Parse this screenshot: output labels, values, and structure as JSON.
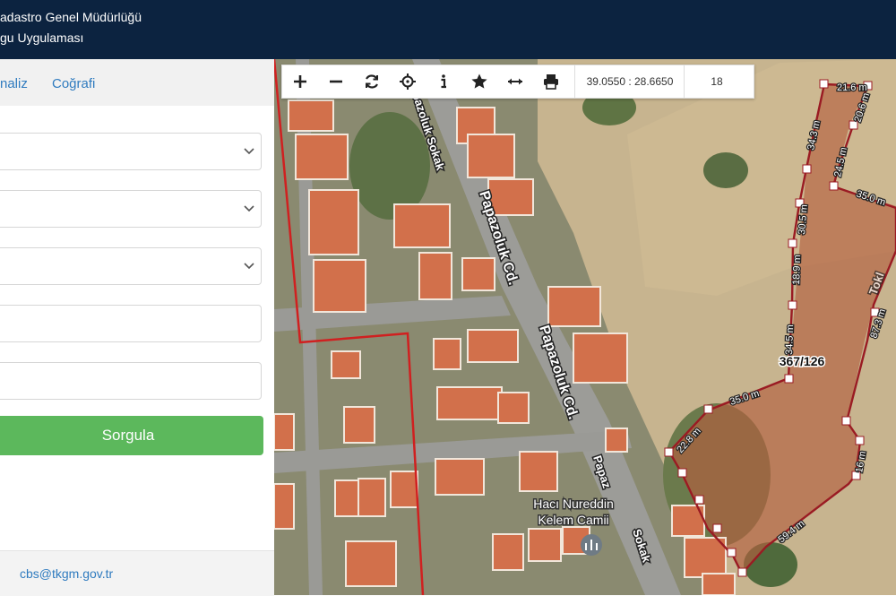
{
  "header": {
    "line1": "adastro Genel Müdürlüğü",
    "line2": "gu Uygulaması"
  },
  "sidebar": {
    "tabs": [
      {
        "label": "naliz"
      },
      {
        "label": "Coğrafi"
      }
    ],
    "query_button": "Sorgula",
    "footer_email": "cbs@tkgm.gov.tr"
  },
  "toolbar": {
    "coordinates": "39.0550 : 28.6650",
    "zoom_level": "18"
  },
  "map": {
    "streets": [
      "Papazoluk Cd.",
      "Papazoluk Cd.",
      "pazoluk Sokak",
      "Papaz",
      "Sokak",
      "Tokl"
    ],
    "poi": "Hacı Nureddin Kelem Camii",
    "poi_line1": "Hacı Nureddin",
    "poi_line2": "Kelem Camii",
    "parcel_label": "367/126",
    "edge_labels": [
      "21.6 m",
      "20.6 m",
      "34.3 m",
      "24.5 m",
      "35.0 m",
      "30.5 m",
      "18.9 m",
      "87.3 m",
      "34.5 m",
      "35.0 m",
      "22.8 m",
      "16 m",
      "59.4 m"
    ]
  }
}
